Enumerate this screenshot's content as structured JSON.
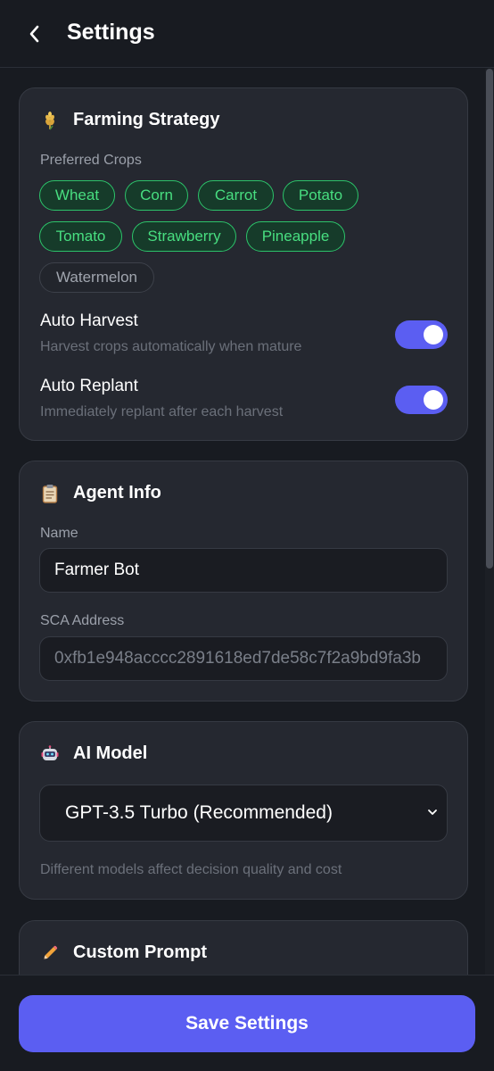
{
  "header": {
    "title": "Settings"
  },
  "farming": {
    "title": "Farming Strategy",
    "crops_label": "Preferred Crops",
    "crops": [
      {
        "name": "Wheat",
        "selected": true
      },
      {
        "name": "Corn",
        "selected": true
      },
      {
        "name": "Carrot",
        "selected": true
      },
      {
        "name": "Potato",
        "selected": true
      },
      {
        "name": "Tomato",
        "selected": true
      },
      {
        "name": "Strawberry",
        "selected": true
      },
      {
        "name": "Pineapple",
        "selected": true
      },
      {
        "name": "Watermelon",
        "selected": false
      }
    ],
    "auto_harvest": {
      "label": "Auto Harvest",
      "desc": "Harvest crops automatically when mature",
      "enabled": true
    },
    "auto_replant": {
      "label": "Auto Replant",
      "desc": "Immediately replant after each harvest",
      "enabled": true
    }
  },
  "agent": {
    "title": "Agent Info",
    "name_label": "Name",
    "name_value": "Farmer Bot",
    "address_label": "SCA Address",
    "address_value": "0xfb1e948acccc2891618ed7de58c7f2a9bd9fa3b"
  },
  "ai_model": {
    "title": "AI Model",
    "selected": "GPT-3.5 Turbo (Recommended)",
    "hint": "Different models affect decision quality and cost"
  },
  "custom_prompt": {
    "title": "Custom Prompt"
  },
  "footer": {
    "save_label": "Save Settings"
  },
  "colors": {
    "accent": "#5b5ef2",
    "chip_selected": "#48de80",
    "background": "#181b21",
    "card": "#252830"
  }
}
